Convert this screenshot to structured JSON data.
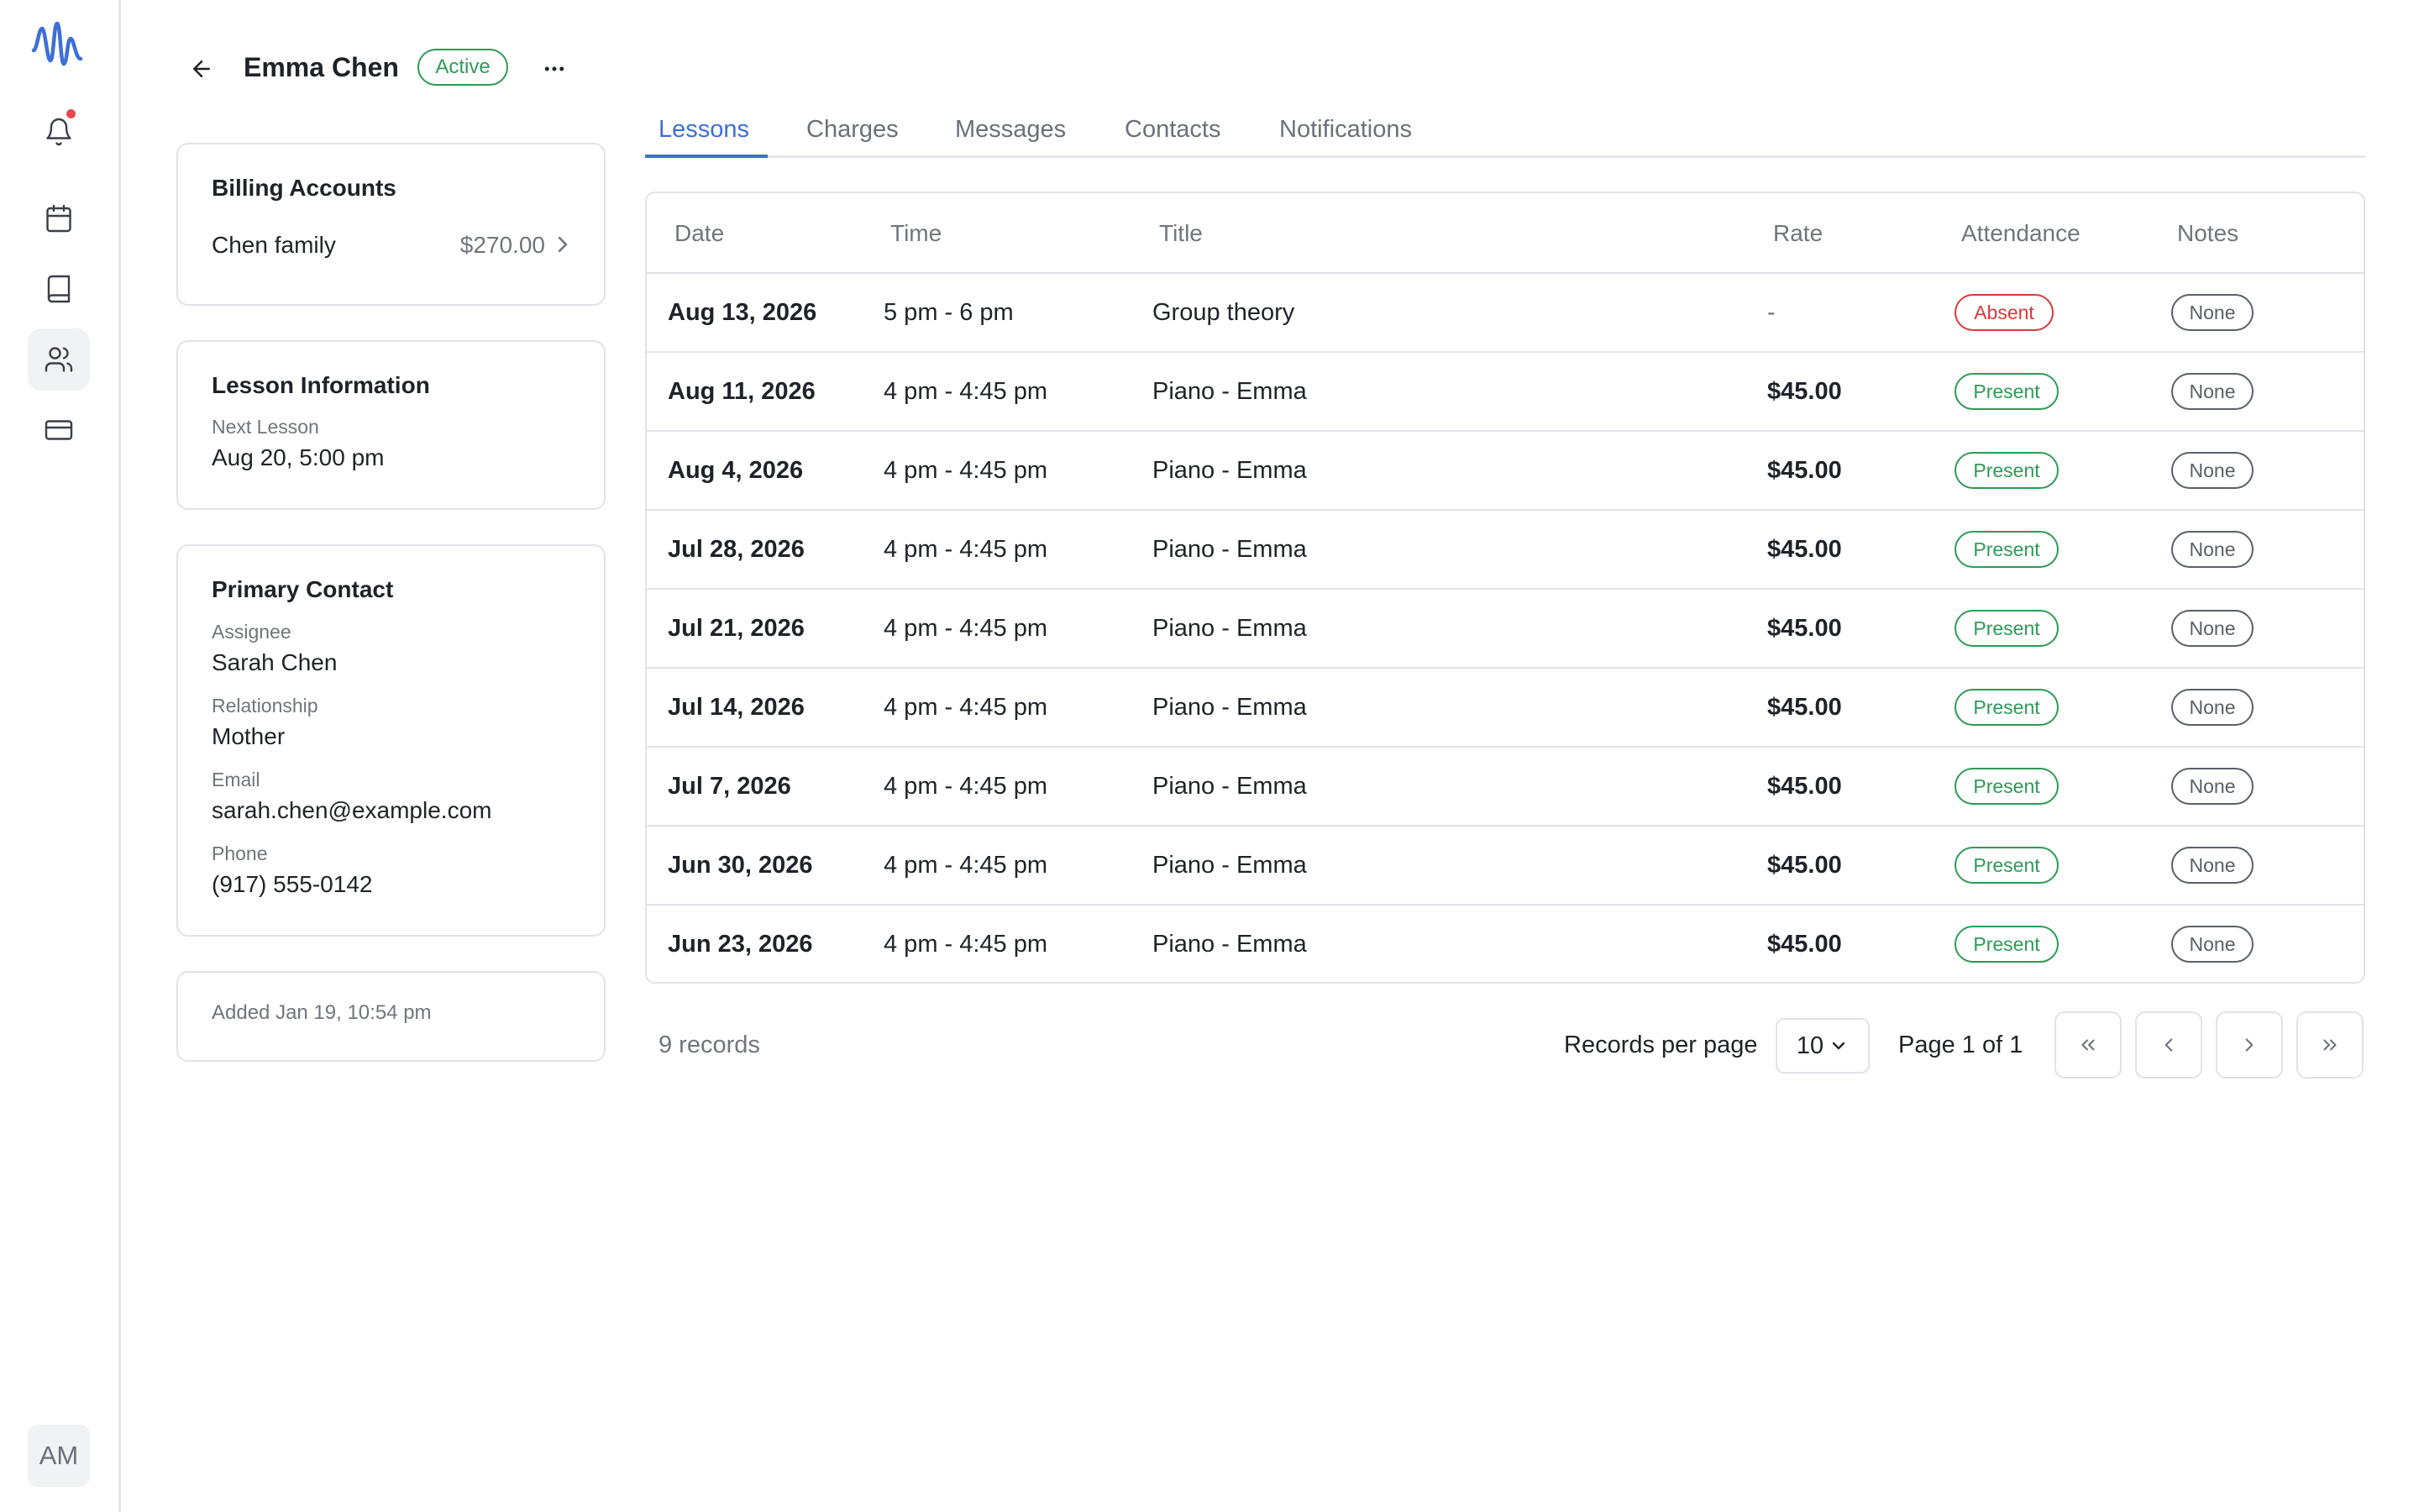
{
  "nav": {
    "items": [
      {
        "icon": "bell-icon",
        "label": "Notifications",
        "has_badge": true
      },
      {
        "icon": "calendar-icon",
        "label": "Calendar"
      },
      {
        "icon": "book-icon",
        "label": "Lessons"
      },
      {
        "icon": "users-icon",
        "label": "Students",
        "active": true
      },
      {
        "icon": "credit-card-icon",
        "label": "Billing"
      }
    ],
    "avatar_initials": "AM"
  },
  "header": {
    "name": "Emma Chen",
    "status": "Active"
  },
  "billing": {
    "title": "Billing Accounts",
    "account_name": "Chen family",
    "amount": "$270.00"
  },
  "lesson_info": {
    "title": "Lesson Information",
    "next_label": "Next Lesson",
    "next_value": "Aug 20, 5:00 pm"
  },
  "primary_contact": {
    "title": "Primary Contact",
    "assignee_label": "Assignee",
    "assignee": "Sarah Chen",
    "relationship_label": "Relationship",
    "relationship": "Mother",
    "email_label": "Email",
    "email": "sarah.chen@example.com",
    "phone_label": "Phone",
    "phone": "(917) 555-0142"
  },
  "added": "Added Jan 19, 10:54 pm",
  "tabs": [
    {
      "label": "Lessons",
      "active": true
    },
    {
      "label": "Charges"
    },
    {
      "label": "Messages"
    },
    {
      "label": "Contacts"
    },
    {
      "label": "Notifications"
    }
  ],
  "table": {
    "columns": [
      "Date",
      "Time",
      "Title",
      "Rate",
      "Attendance",
      "Notes"
    ],
    "rows": [
      {
        "date": "Aug 13, 2026",
        "time": "5 pm - 6 pm",
        "title": "Group theory",
        "rate": "-",
        "attendance": "Absent",
        "notes": "None"
      },
      {
        "date": "Aug 11, 2026",
        "time": "4 pm - 4:45 pm",
        "title": "Piano - Emma",
        "rate": "$45.00",
        "attendance": "Present",
        "notes": "None"
      },
      {
        "date": "Aug 4, 2026",
        "time": "4 pm - 4:45 pm",
        "title": "Piano - Emma",
        "rate": "$45.00",
        "attendance": "Present",
        "notes": "None"
      },
      {
        "date": "Jul 28, 2026",
        "time": "4 pm - 4:45 pm",
        "title": "Piano - Emma",
        "rate": "$45.00",
        "attendance": "Present",
        "notes": "None"
      },
      {
        "date": "Jul 21, 2026",
        "time": "4 pm - 4:45 pm",
        "title": "Piano - Emma",
        "rate": "$45.00",
        "attendance": "Present",
        "notes": "None"
      },
      {
        "date": "Jul 14, 2026",
        "time": "4 pm - 4:45 pm",
        "title": "Piano - Emma",
        "rate": "$45.00",
        "attendance": "Present",
        "notes": "None"
      },
      {
        "date": "Jul 7, 2026",
        "time": "4 pm - 4:45 pm",
        "title": "Piano - Emma",
        "rate": "$45.00",
        "attendance": "Present",
        "notes": "None"
      },
      {
        "date": "Jun 30, 2026",
        "time": "4 pm - 4:45 pm",
        "title": "Piano - Emma",
        "rate": "$45.00",
        "attendance": "Present",
        "notes": "None"
      },
      {
        "date": "Jun 23, 2026",
        "time": "4 pm - 4:45 pm",
        "title": "Piano - Emma",
        "rate": "$45.00",
        "attendance": "Present",
        "notes": "None"
      }
    ]
  },
  "pagination": {
    "records": "9 records",
    "per_page_label": "Records per page",
    "per_page_value": "10",
    "page_info": "Page 1 of 1"
  },
  "colors": {
    "accent": "#3d6fd9",
    "present": "#2e9b56",
    "absent": "#d93a3a",
    "notification_dot": "#e5484d"
  }
}
